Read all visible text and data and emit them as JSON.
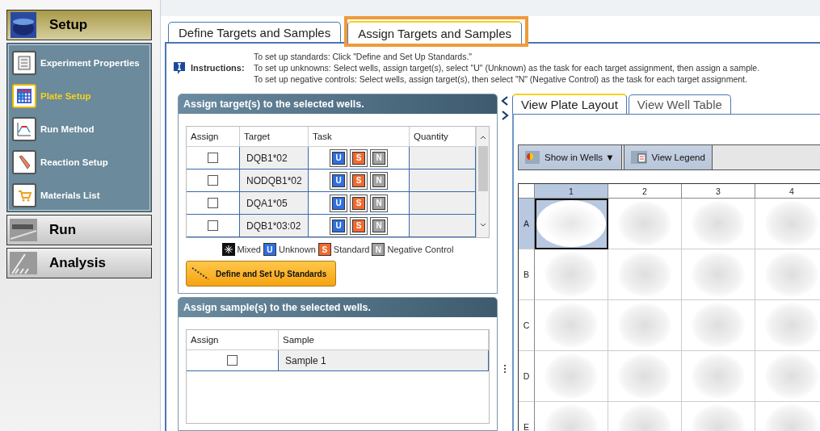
{
  "sidebar": {
    "sections": [
      {
        "label": "Setup",
        "expanded": true,
        "items": [
          {
            "label": "Experiment Properties",
            "selected": false
          },
          {
            "label": "Plate Setup",
            "selected": true
          },
          {
            "label": "Run Method",
            "selected": false
          },
          {
            "label": "Reaction Setup",
            "selected": false
          },
          {
            "label": "Materials List",
            "selected": false
          }
        ]
      },
      {
        "label": "Run",
        "expanded": false
      },
      {
        "label": "Analysis",
        "expanded": false
      }
    ]
  },
  "tabs": [
    {
      "label": "Define Targets and Samples",
      "selected": false,
      "highlighted": false
    },
    {
      "label": "Assign Targets and Samples",
      "selected": true,
      "highlighted": true
    }
  ],
  "instructions": {
    "label": "Instructions:",
    "lines": [
      "To set up standards: Click \"Define and Set Up Standards.\"",
      "To set up unknowns: Select wells, assign target(s), select \"U\" (Unknown) as the task for each target assignment, then assign a sample.",
      "To set up negative controls: Select wells, assign target(s), then select \"N\" (Negative Control) as the task for each target assignment."
    ]
  },
  "targets_panel": {
    "title": "Assign target(s) to the selected wells.",
    "columns": [
      "Assign",
      "Target",
      "Task",
      "Quantity"
    ],
    "rows": [
      {
        "checked": false,
        "target": "DQB1*02",
        "tasks": [
          {
            "kind": "unknown",
            "letter": "U"
          },
          {
            "kind": "standard",
            "letter": "S"
          },
          {
            "kind": "negative",
            "letter": "N"
          }
        ]
      },
      {
        "checked": false,
        "target": "NODQB1*02",
        "tasks": [
          {
            "kind": "unknown",
            "letter": "U"
          },
          {
            "kind": "standard",
            "letter": "S"
          },
          {
            "kind": "negative",
            "letter": "N"
          }
        ]
      },
      {
        "checked": false,
        "target": "DQA1*05",
        "tasks": [
          {
            "kind": "unknown",
            "letter": "U"
          },
          {
            "kind": "standard",
            "letter": "S"
          },
          {
            "kind": "negative",
            "letter": "N"
          }
        ]
      },
      {
        "checked": false,
        "target": "DQB1*03:02",
        "tasks": [
          {
            "kind": "unknown",
            "letter": "U"
          },
          {
            "kind": "standard",
            "letter": "S"
          },
          {
            "kind": "negative",
            "letter": "N"
          }
        ]
      }
    ],
    "legend": [
      {
        "kind": "mixed",
        "label": "Mixed"
      },
      {
        "kind": "unknown",
        "letter": "U",
        "label": "Unknown"
      },
      {
        "kind": "standard",
        "letter": "S",
        "label": "Standard"
      },
      {
        "kind": "negative",
        "letter": "N",
        "label": "Negative Control"
      }
    ],
    "button": "Define and Set Up Standards"
  },
  "samples_panel": {
    "title": "Assign sample(s) to the selected wells.",
    "columns": [
      "Assign",
      "Sample"
    ],
    "rows": [
      {
        "checked": false,
        "sample": "Sample 1"
      }
    ]
  },
  "view_tabs": [
    {
      "label": "View Plate Layout",
      "selected": true
    },
    {
      "label": "View Well Table",
      "selected": false
    }
  ],
  "toolbar": {
    "show_in_wells": "Show in Wells",
    "dropdown_arrow": "▼",
    "view_legend": "View Legend"
  },
  "plate": {
    "columns": [
      {
        "label": "1",
        "selected": true
      },
      {
        "label": "2",
        "selected": false
      },
      {
        "label": "3",
        "selected": false
      },
      {
        "label": "4",
        "selected": false
      }
    ],
    "rows": [
      {
        "label": "A",
        "selected": true
      },
      {
        "label": "B",
        "selected": false
      },
      {
        "label": "C",
        "selected": false
      },
      {
        "label": "D",
        "selected": false
      },
      {
        "label": "E",
        "selected": false
      }
    ]
  }
}
